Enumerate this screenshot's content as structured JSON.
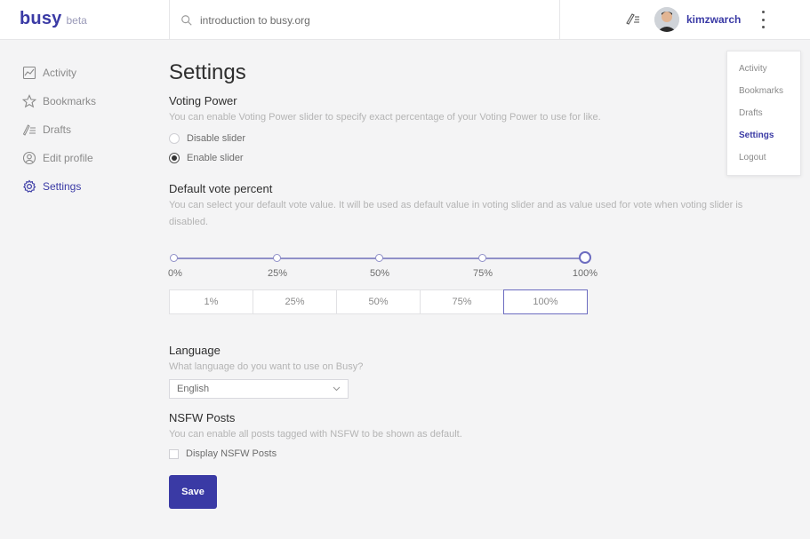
{
  "header": {
    "brand": "busy",
    "brand_tag": "beta",
    "search_value": "introduction to busy.org",
    "username": "kimzwarch",
    "icons": [
      "search-icon",
      "write-icon",
      "avatar",
      "more-vertical-icon"
    ]
  },
  "sidebar": {
    "items": [
      {
        "label": "Activity",
        "icon": "activity-icon"
      },
      {
        "label": "Bookmarks",
        "icon": "star-icon"
      },
      {
        "label": "Drafts",
        "icon": "drafts-icon"
      },
      {
        "label": "Edit profile",
        "icon": "profile-icon"
      },
      {
        "label": "Settings",
        "icon": "settings-icon",
        "active": true
      }
    ]
  },
  "main": {
    "title": "Settings",
    "voting_power": {
      "title": "Voting Power",
      "description": "You can enable Voting Power slider to specify exact percentage of your Voting Power to use for like.",
      "options": [
        "Disable slider",
        "Enable slider"
      ],
      "selected": "Enable slider"
    },
    "default_vote": {
      "title": "Default vote percent",
      "description": "You can select your default vote value. It will be used as default value in voting slider and as value used for vote when voting slider is disabled.",
      "slider_labels": [
        "0%",
        "25%",
        "50%",
        "75%",
        "100%"
      ],
      "slider_value_percent": 100,
      "buttons": [
        "1%",
        "25%",
        "50%",
        "75%",
        "100%"
      ],
      "selected_button": "100%"
    },
    "language": {
      "title": "Language",
      "description": "What language do you want to use on Busy?",
      "value": "English"
    },
    "nsfw": {
      "title": "NSFW Posts",
      "description": "You can enable all posts tagged with NSFW to be shown as default.",
      "checkbox_label": "Display NSFW Posts",
      "checked": false
    },
    "save_label": "Save"
  },
  "dropdown": {
    "items": [
      "Activity",
      "Bookmarks",
      "Drafts",
      "Settings",
      "Logout"
    ],
    "active": "Settings"
  },
  "colors": {
    "brand": "#3a3aa5",
    "slider": "#9090c8",
    "background": "#f4f4f5"
  }
}
